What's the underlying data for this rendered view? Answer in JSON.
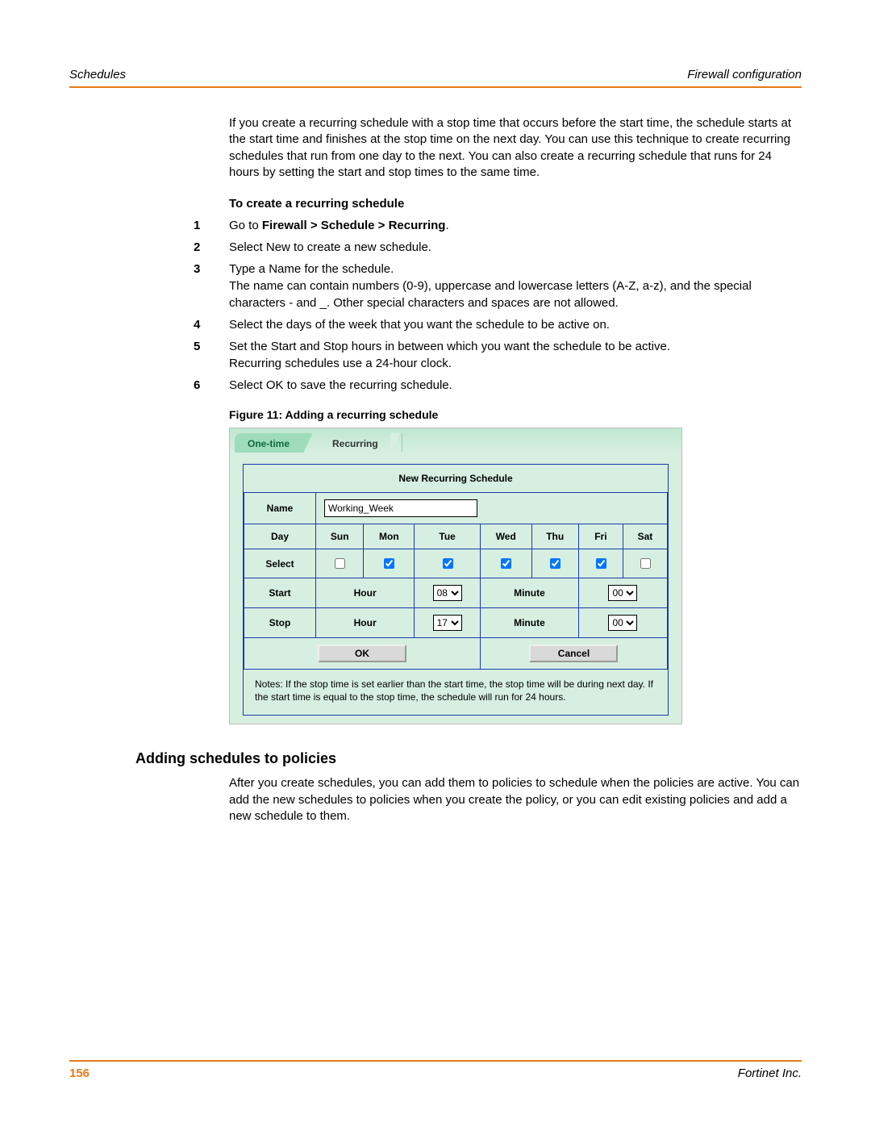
{
  "header": {
    "left": "Schedules",
    "right": "Firewall configuration"
  },
  "intro": "If you create a recurring schedule with a stop time that occurs before the start time, the schedule starts at the start time and finishes at the stop time on the next day. You can use this technique to create recurring schedules that run from one day to the next. You can also create a recurring schedule that runs for 24 hours by setting the start and stop times to the same time.",
  "subhead": "To create a recurring schedule",
  "steps": [
    {
      "n": "1",
      "pre": "Go to ",
      "bold": "Firewall > Schedule > Recurring",
      "post": "."
    },
    {
      "n": "2",
      "text": "Select New to create a new schedule."
    },
    {
      "n": "3",
      "text": "Type a Name for the schedule.",
      "text2": "The name can contain numbers (0-9), uppercase and lowercase letters (A-Z, a-z), and the special characters - and _. Other special characters and spaces are not allowed."
    },
    {
      "n": "4",
      "text": "Select the days of the week that you want the schedule to be active on."
    },
    {
      "n": "5",
      "text": "Set the Start and Stop hours in between which you want the schedule to be active.",
      "text2": "Recurring schedules use a 24-hour clock."
    },
    {
      "n": "6",
      "text": "Select OK to save the recurring schedule."
    }
  ],
  "figure_caption": "Figure 11: Adding a recurring schedule",
  "ui": {
    "tabs": {
      "one_time": "One-time",
      "recurring": "Recurring"
    },
    "title": "New Recurring Schedule",
    "name_label": "Name",
    "name_value": "Working_Week",
    "day_label": "Day",
    "select_label": "Select",
    "days": [
      "Sun",
      "Mon",
      "Tue",
      "Wed",
      "Thu",
      "Fri",
      "Sat"
    ],
    "checks": [
      false,
      true,
      true,
      true,
      true,
      true,
      false
    ],
    "start_label": "Start",
    "stop_label": "Stop",
    "hour_label": "Hour",
    "minute_label": "Minute",
    "start_hour": "08",
    "start_minute": "00",
    "stop_hour": "17",
    "stop_minute": "00",
    "ok": "OK",
    "cancel": "Cancel",
    "notes": "Notes: If the stop time is set earlier than the start time, the stop time will be during next day. If the start time is equal to the stop time, the schedule will run for 24 hours."
  },
  "section2": {
    "title": "Adding schedules to policies",
    "body": "After you create schedules, you can add them to policies to schedule when the policies are active. You can add the new schedules to policies when you create the policy, or you can edit existing policies and add a new schedule to them."
  },
  "footer": {
    "page": "156",
    "right": "Fortinet Inc."
  }
}
